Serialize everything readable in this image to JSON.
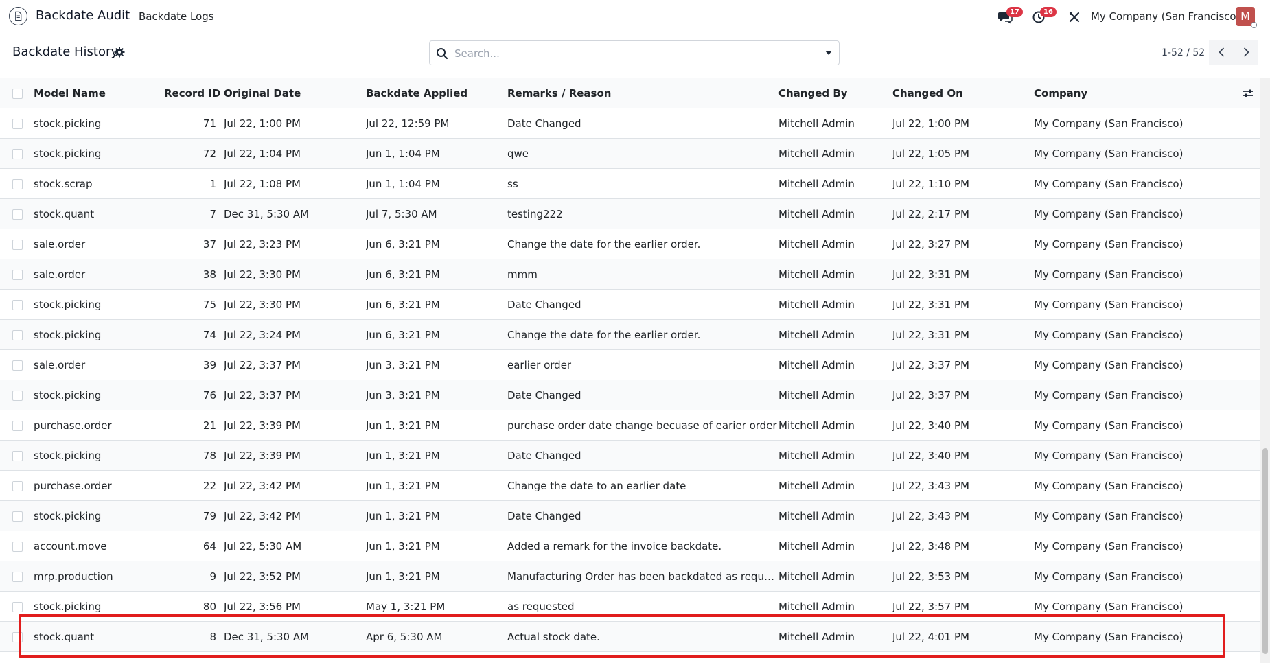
{
  "navbar": {
    "app_name": "Backdate Audit",
    "menu_item": "Backdate Logs",
    "messages_count": "17",
    "activities_count": "16",
    "company": "My Company (San Francisco)",
    "avatar_initial": "M"
  },
  "control_panel": {
    "title": "Backdate History",
    "search_placeholder": "Search...",
    "pager": "1-52 / 52"
  },
  "table": {
    "columns": {
      "model": "Model Name",
      "record_id": "Record ID",
      "original": "Original Date",
      "applied": "Backdate Applied",
      "remarks": "Remarks / Reason",
      "changed_by": "Changed By",
      "changed_on": "Changed On",
      "company": "Company"
    },
    "rows": [
      {
        "model": "stock.picking",
        "record_id": "71",
        "original": "Jul 22, 1:00 PM",
        "applied": "Jul 22, 12:59 PM",
        "remarks": "Date Changed",
        "changed_by": "Mitchell Admin",
        "changed_on": "Jul 22, 1:00 PM",
        "company": "My Company (San Francisco)"
      },
      {
        "model": "stock.picking",
        "record_id": "72",
        "original": "Jul 22, 1:04 PM",
        "applied": "Jun 1, 1:04 PM",
        "remarks": "qwe",
        "changed_by": "Mitchell Admin",
        "changed_on": "Jul 22, 1:05 PM",
        "company": "My Company (San Francisco)"
      },
      {
        "model": "stock.scrap",
        "record_id": "1",
        "original": "Jul 22, 1:08 PM",
        "applied": "Jun 1, 1:04 PM",
        "remarks": "ss",
        "changed_by": "Mitchell Admin",
        "changed_on": "Jul 22, 1:10 PM",
        "company": "My Company (San Francisco)"
      },
      {
        "model": "stock.quant",
        "record_id": "7",
        "original": "Dec 31, 5:30 AM",
        "applied": "Jul 7, 5:30 AM",
        "remarks": "testing222",
        "changed_by": "Mitchell Admin",
        "changed_on": "Jul 22, 2:17 PM",
        "company": "My Company (San Francisco)"
      },
      {
        "model": "sale.order",
        "record_id": "37",
        "original": "Jul 22, 3:23 PM",
        "applied": "Jun 6, 3:21 PM",
        "remarks": "Change the date for the earlier order.",
        "changed_by": "Mitchell Admin",
        "changed_on": "Jul 22, 3:27 PM",
        "company": "My Company (San Francisco)"
      },
      {
        "model": "sale.order",
        "record_id": "38",
        "original": "Jul 22, 3:30 PM",
        "applied": "Jun 6, 3:21 PM",
        "remarks": "mmm",
        "changed_by": "Mitchell Admin",
        "changed_on": "Jul 22, 3:31 PM",
        "company": "My Company (San Francisco)"
      },
      {
        "model": "stock.picking",
        "record_id": "75",
        "original": "Jul 22, 3:30 PM",
        "applied": "Jun 6, 3:21 PM",
        "remarks": "Date Changed",
        "changed_by": "Mitchell Admin",
        "changed_on": "Jul 22, 3:31 PM",
        "company": "My Company (San Francisco)"
      },
      {
        "model": "stock.picking",
        "record_id": "74",
        "original": "Jul 22, 3:24 PM",
        "applied": "Jun 6, 3:21 PM",
        "remarks": "Change the date for the earlier order.",
        "changed_by": "Mitchell Admin",
        "changed_on": "Jul 22, 3:31 PM",
        "company": "My Company (San Francisco)"
      },
      {
        "model": "sale.order",
        "record_id": "39",
        "original": "Jul 22, 3:37 PM",
        "applied": "Jun 3, 3:21 PM",
        "remarks": "earlier order",
        "changed_by": "Mitchell Admin",
        "changed_on": "Jul 22, 3:37 PM",
        "company": "My Company (San Francisco)"
      },
      {
        "model": "stock.picking",
        "record_id": "76",
        "original": "Jul 22, 3:37 PM",
        "applied": "Jun 3, 3:21 PM",
        "remarks": "Date Changed",
        "changed_by": "Mitchell Admin",
        "changed_on": "Jul 22, 3:37 PM",
        "company": "My Company (San Francisco)"
      },
      {
        "model": "purchase.order",
        "record_id": "21",
        "original": "Jul 22, 3:39 PM",
        "applied": "Jun 1, 3:21 PM",
        "remarks": "purchase order date change becuase of earier order",
        "changed_by": "Mitchell Admin",
        "changed_on": "Jul 22, 3:40 PM",
        "company": "My Company (San Francisco)"
      },
      {
        "model": "stock.picking",
        "record_id": "78",
        "original": "Jul 22, 3:39 PM",
        "applied": "Jun 1, 3:21 PM",
        "remarks": "Date Changed",
        "changed_by": "Mitchell Admin",
        "changed_on": "Jul 22, 3:40 PM",
        "company": "My Company (San Francisco)"
      },
      {
        "model": "purchase.order",
        "record_id": "22",
        "original": "Jul 22, 3:42 PM",
        "applied": "Jun 1, 3:21 PM",
        "remarks": "Change the date to an earlier date",
        "changed_by": "Mitchell Admin",
        "changed_on": "Jul 22, 3:43 PM",
        "company": "My Company (San Francisco)"
      },
      {
        "model": "stock.picking",
        "record_id": "79",
        "original": "Jul 22, 3:42 PM",
        "applied": "Jun 1, 3:21 PM",
        "remarks": "Date Changed",
        "changed_by": "Mitchell Admin",
        "changed_on": "Jul 22, 3:43 PM",
        "company": "My Company (San Francisco)"
      },
      {
        "model": "account.move",
        "record_id": "64",
        "original": "Jul 22, 5:30 AM",
        "applied": "Jun 1, 3:21 PM",
        "remarks": "Added a remark for the invoice backdate.",
        "changed_by": "Mitchell Admin",
        "changed_on": "Jul 22, 3:48 PM",
        "company": "My Company (San Francisco)"
      },
      {
        "model": "mrp.production",
        "record_id": "9",
        "original": "Jul 22, 3:52 PM",
        "applied": "Jun 1, 3:21 PM",
        "remarks": "Manufacturing Order has been backdated as request…",
        "changed_by": "Mitchell Admin",
        "changed_on": "Jul 22, 3:53 PM",
        "company": "My Company (San Francisco)"
      },
      {
        "model": "stock.picking",
        "record_id": "80",
        "original": "Jul 22, 3:56 PM",
        "applied": "May 1, 3:21 PM",
        "remarks": "as requested",
        "changed_by": "Mitchell Admin",
        "changed_on": "Jul 22, 3:57 PM",
        "company": "My Company (San Francisco)"
      },
      {
        "model": "stock.quant",
        "record_id": "8",
        "original": "Dec 31, 5:30 AM",
        "applied": "Apr 6, 5:30 AM",
        "remarks": "Actual stock date.",
        "changed_by": "Mitchell Admin",
        "changed_on": "Jul 22, 4:01 PM",
        "company": "My Company (San Francisco)"
      }
    ]
  },
  "colors": {
    "badge": "#dc3545",
    "avatar": "#c0504d",
    "highlight": "#e11d1d"
  }
}
